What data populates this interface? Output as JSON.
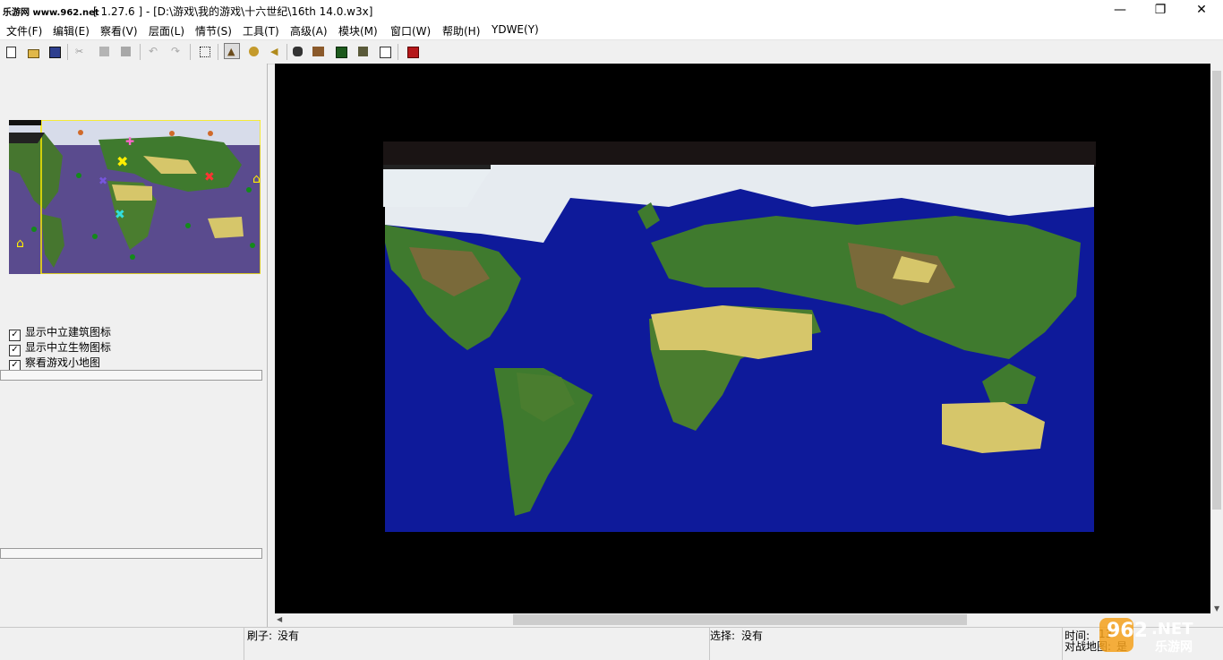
{
  "window": {
    "logo_text": "乐游网 www.962.net",
    "title": "[ 1.27.6 ] - [D:\\游戏\\我的游戏\\十六世纪\\16th 14.0.w3x]",
    "minimize_glyph": "—",
    "maximize_glyph": "❐",
    "close_glyph": "✕"
  },
  "menu": [
    {
      "label": "文件(F)"
    },
    {
      "label": "编辑(E)"
    },
    {
      "label": "察看(V)"
    },
    {
      "label": "层面(L)"
    },
    {
      "label": "情节(S)"
    },
    {
      "label": "工具(T)"
    },
    {
      "label": "高级(A)"
    },
    {
      "label": "模块(M)"
    },
    {
      "label": "窗口(W)"
    },
    {
      "label": "帮助(H)"
    },
    {
      "label": "YDWE(Y)"
    }
  ],
  "toolbar": {
    "buttons": [
      "new-file-icon",
      "open-folder-icon",
      "save-icon",
      "cut-icon",
      "copy-icon",
      "paste-icon",
      "undo-icon",
      "redo-icon",
      "select-region-icon",
      "terrain-editor-icon",
      "unit-editor-icon",
      "sound-editor-icon",
      "object-editor-icon",
      "campaign-editor-icon",
      "ai-editor-icon",
      "import-manager-icon",
      "trigger-editor-icon",
      "test-map-icon"
    ]
  },
  "left_panel": {
    "checkboxes": [
      {
        "label": "显示中立建筑图标",
        "checked": true
      },
      {
        "label": "显示中立生物图标",
        "checked": true
      },
      {
        "label": "察看游戏小地图",
        "checked": true
      }
    ]
  },
  "statusbar": {
    "brush_label": "刷子:",
    "brush_value": "没有",
    "selection_label": "选择:",
    "selection_value": "没有",
    "time_label": "时间:",
    "time_value": "13",
    "melee_label": "对战地图:",
    "melee_value": "是"
  },
  "watermark": {
    "text_main": "962",
    "text_net": ".NET",
    "text_sub": "乐游网"
  },
  "colors": {
    "ocean": "#0e1a9a",
    "minimap_ocean": "#5a4b8e",
    "land_green": "#3f7a2e",
    "desert": "#d6c66a",
    "snow": "#e8eef2"
  }
}
